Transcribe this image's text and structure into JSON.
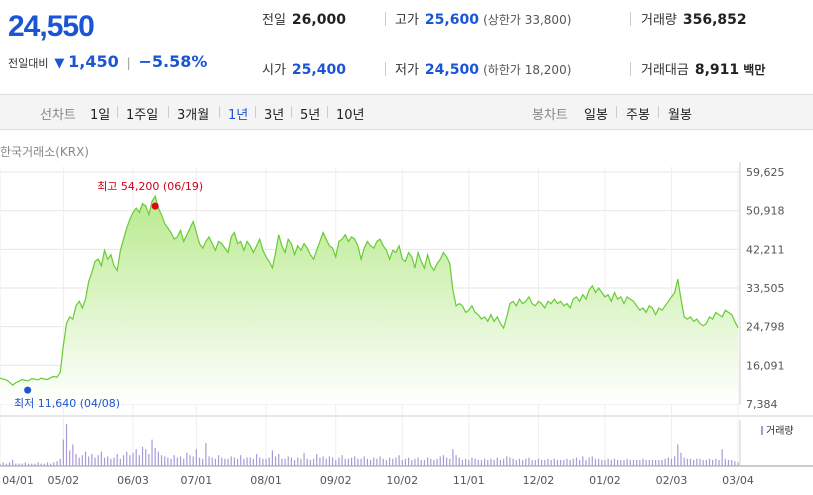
{
  "quote": {
    "price": "24,550",
    "change_label": "전일대비",
    "change_arrow": "▼",
    "change_value": "1,450",
    "change_rate": "−5.58%",
    "prev_close_label": "전일",
    "prev_close": "26,000",
    "high_label": "고가",
    "high": "25,600",
    "upper_limit": "(상한가 33,800)",
    "volume_label": "거래량",
    "volume": "356,852",
    "open_label": "시가",
    "open": "25,400",
    "low_label": "저가",
    "low": "24,500",
    "lower_limit": "(하한가 18,200)",
    "amount_label": "거래대금",
    "amount": "8,911",
    "amount_unit": "백만"
  },
  "toolbar": {
    "line_label": "선차트",
    "line_periods": [
      "1일",
      "1주일",
      "3개월",
      "1년",
      "3년",
      "5년",
      "10년"
    ],
    "active_period": "1년",
    "candle_label": "봉차트",
    "candle_periods": [
      "일봉",
      "주봉",
      "월봉"
    ]
  },
  "exchange_label": "한국거래소(KRX)",
  "colors": {
    "line": "#66cc33",
    "fill_top": "#b9ea8e",
    "fill_bottom": "#ffffff",
    "volume": "#a89ad6",
    "high_marker": "#e8001b",
    "low_marker": "#1a55d6"
  },
  "chart_data": {
    "type": "area",
    "y_ticks": [
      7384,
      16091,
      24798,
      33505,
      42211,
      50918,
      59625
    ],
    "y_tick_labels": [
      "7,384",
      "16,091",
      "24,798",
      "33,505",
      "42,211",
      "50,918",
      "59,625"
    ],
    "ylim": [
      7384,
      59625
    ],
    "x_tick_labels": [
      "04/01",
      "05/02",
      "06/03",
      "07/01",
      "08/01",
      "09/02",
      "10/02",
      "11/01",
      "12/02",
      "01/02",
      "02/03",
      "03/04"
    ],
    "x_tick_index": [
      0,
      20,
      42,
      62,
      84,
      106,
      127,
      148,
      170,
      191,
      212,
      233
    ],
    "values": [
      13200,
      13000,
      12800,
      12300,
      11640,
      12200,
      12500,
      12900,
      12700,
      12600,
      13100,
      13000,
      12800,
      13200,
      13000,
      12900,
      13300,
      13600,
      13400,
      14500,
      20500,
      25500,
      27000,
      26500,
      29500,
      30500,
      29000,
      31000,
      35000,
      37000,
      39500,
      40000,
      38500,
      42000,
      40000,
      41000,
      38500,
      37500,
      42000,
      44500,
      47000,
      49000,
      50500,
      51500,
      50500,
      52500,
      52000,
      50000,
      53000,
      54200,
      51500,
      50000,
      48000,
      47000,
      46000,
      44500,
      45000,
      46500,
      44000,
      45500,
      47000,
      48500,
      46000,
      43500,
      42500,
      44000,
      45000,
      43500,
      42000,
      44000,
      43500,
      42500,
      41500,
      45000,
      46000,
      43500,
      44000,
      42000,
      44000,
      43000,
      41500,
      43000,
      44500,
      42000,
      40500,
      39500,
      38000,
      41500,
      45500,
      43000,
      41500,
      44500,
      43500,
      41000,
      43000,
      42000,
      43500,
      42500,
      41000,
      40000,
      42000,
      44000,
      46000,
      44500,
      43000,
      42500,
      40500,
      44000,
      44500,
      45500,
      44000,
      45000,
      44500,
      43000,
      40000,
      42500,
      44000,
      43000,
      42500,
      44000,
      44500,
      43000,
      42000,
      40000,
      42000,
      41500,
      43000,
      40000,
      39500,
      41500,
      40500,
      38000,
      41500,
      39500,
      38000,
      41000,
      38500,
      37500,
      39000,
      40000,
      41500,
      40500,
      39000,
      33000,
      29500,
      30000,
      29500,
      28000,
      28500,
      29500,
      28000,
      27500,
      26500,
      27000,
      26000,
      27500,
      26000,
      27000,
      25500,
      24500,
      27000,
      30000,
      30500,
      29500,
      31000,
      30000,
      30500,
      31500,
      30000,
      29500,
      30500,
      30000,
      29000,
      30500,
      30000,
      31000,
      30000,
      30500,
      29500,
      30000,
      29000,
      31000,
      31500,
      30500,
      32000,
      31000,
      33000,
      34000,
      32500,
      33500,
      32500,
      31500,
      32000,
      30500,
      32500,
      31000,
      31500,
      30000,
      31500,
      31000,
      30500,
      29500,
      28500,
      29000,
      28000,
      29500,
      29000,
      27500,
      29000,
      28500,
      29500,
      30500,
      31500,
      32500,
      35500,
      31000,
      27000,
      26500,
      27000,
      26000,
      26500,
      25500,
      25000,
      25500,
      27000,
      26500,
      28000,
      27500,
      27000,
      28500,
      28000,
      27500,
      26000,
      24550
    ],
    "high_annotation": {
      "label": "최고 54,200 (06/19)",
      "index": 49,
      "value": 54200
    },
    "low_annotation": {
      "label": "최저 11,640 (04/08)",
      "index": 4,
      "value": 11640
    },
    "volume_legend": "거래량",
    "volume": [
      2,
      3,
      2,
      3,
      5,
      2,
      2,
      2,
      3,
      2,
      2,
      2,
      3,
      2,
      2,
      3,
      2,
      3,
      4,
      6,
      22,
      35,
      13,
      18,
      10,
      7,
      9,
      12,
      8,
      10,
      7,
      9,
      12,
      7,
      8,
      6,
      7,
      10,
      6,
      9,
      12,
      9,
      11,
      14,
      9,
      16,
      14,
      10,
      22,
      15,
      12,
      9,
      8,
      7,
      6,
      9,
      7,
      8,
      6,
      11,
      9,
      8,
      14,
      7,
      6,
      19,
      8,
      7,
      6,
      9,
      7,
      6,
      6,
      8,
      7,
      6,
      9,
      6,
      7,
      7,
      6,
      10,
      7,
      6,
      6,
      7,
      13,
      8,
      10,
      6,
      6,
      8,
      7,
      5,
      7,
      6,
      11,
      6,
      5,
      6,
      10,
      7,
      8,
      6,
      8,
      7,
      5,
      7,
      9,
      6,
      6,
      7,
      8,
      6,
      6,
      8,
      6,
      5,
      7,
      6,
      8,
      6,
      5,
      7,
      6,
      7,
      9,
      5,
      6,
      7,
      5,
      6,
      7,
      5,
      5,
      7,
      6,
      5,
      6,
      8,
      9,
      7,
      6,
      14,
      9,
      7,
      5,
      6,
      5,
      7,
      6,
      5,
      5,
      6,
      5,
      6,
      5,
      7,
      5,
      6,
      8,
      7,
      6,
      5,
      6,
      5,
      6,
      7,
      5,
      5,
      6,
      5,
      5,
      6,
      5,
      6,
      5,
      5,
      5,
      6,
      5,
      6,
      7,
      5,
      8,
      5,
      7,
      8,
      6,
      6,
      5,
      5,
      6,
      5,
      6,
      5,
      5,
      5,
      6,
      5,
      5,
      5,
      5,
      6,
      5,
      5,
      5,
      5,
      5,
      5,
      6,
      7,
      6,
      8,
      18,
      11,
      7,
      6,
      6,
      5,
      6,
      6,
      5,
      5,
      6,
      5,
      6,
      5,
      14,
      6,
      5,
      5,
      4,
      3
    ]
  }
}
